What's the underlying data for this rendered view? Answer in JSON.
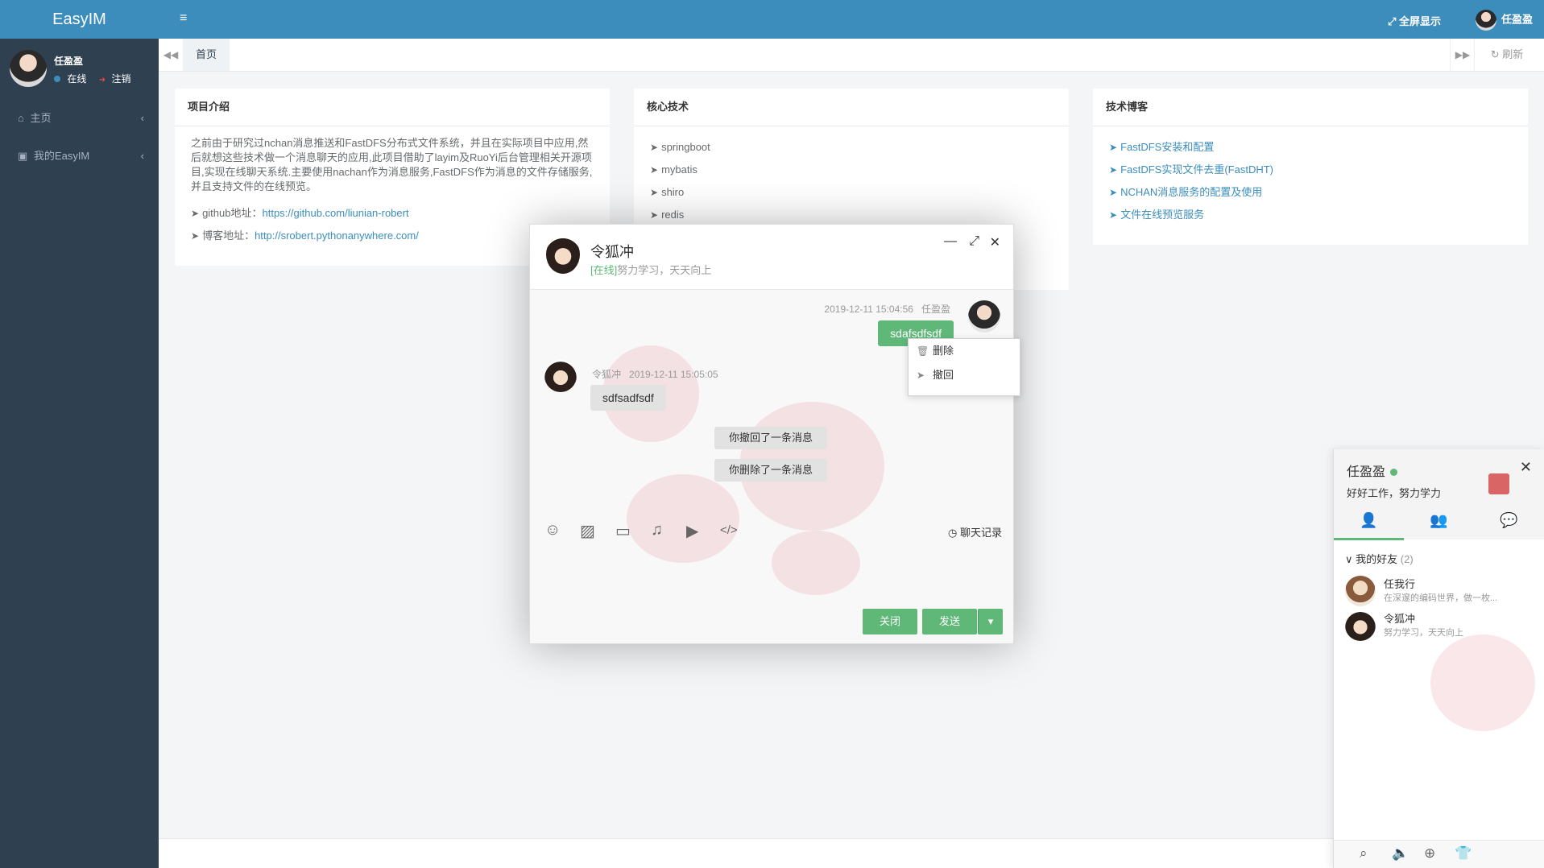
{
  "app": {
    "logo": "EasyIM"
  },
  "sidebar": {
    "user_name": "任盈盈",
    "status": "在线",
    "logout": "注销",
    "items": [
      {
        "icon": "home-icon",
        "glyph": "⌂",
        "label": "主页"
      },
      {
        "icon": "user-card-icon",
        "glyph": "▣",
        "label": "我的EasyIM"
      }
    ]
  },
  "topbar": {
    "menu_glyph": "≡",
    "fullscreen": "全屏显示",
    "user_name": "任盈盈"
  },
  "tabs": {
    "home": "首页",
    "refresh": "刷新"
  },
  "panels": {
    "intro": {
      "title": "项目介绍",
      "text": "之前由于研究过nchan消息推送和FastDFS分布式文件系统，并且在实际项目中应用,然后就想这些技术做一个消息聊天的应用,此项目借助了layim及RuoYi后台管理相关开源项目,实现在线聊天系统.主要使用nachan作为消息服务,FastDFS作为消息的文件存储服务,并且支持文件的在线预览。",
      "github_label": "github地址：",
      "github_url": "https://github.com/liunian-robert",
      "blog_label": "博客地址：",
      "blog_url": "http://srobert.pythonanywhere.com/"
    },
    "tech": {
      "title": "核心技术",
      "items": [
        "springboot",
        "mybatis",
        "shiro",
        "redis"
      ]
    },
    "blog": {
      "title": "技术博客",
      "items": [
        "FastDFS安装和配置",
        "FastDFS实现文件去重(FastDHT)",
        "NCHAN消息服务的配置及使用",
        "文件在线预览服务"
      ]
    }
  },
  "chat": {
    "name": "令狐冲",
    "status": "[在线]",
    "signature": "努力学习，天天向上",
    "messages": {
      "me": {
        "time": "2019-12-11 15:04:56",
        "name": "任盈盈",
        "text": "sdafsdfsdf"
      },
      "other": {
        "name": "令狐冲",
        "time": "2019-12-11 15:05:05",
        "text": "sdfsadfsdf"
      },
      "system": [
        "你撤回了一条消息",
        "你删除了一条消息"
      ]
    },
    "context_menu": [
      {
        "icon": "trash-icon",
        "glyph": "🗑",
        "label": "删除"
      },
      {
        "icon": "send-icon",
        "glyph": "➤",
        "label": "撤回"
      }
    ],
    "tools": [
      "smile-icon",
      "image-icon",
      "folder-icon",
      "headphones-icon",
      "video-icon",
      "code-icon"
    ],
    "tool_glyphs": [
      "☺",
      "▨",
      "▭",
      "♫",
      "▶",
      "</>"
    ],
    "history": "聊天记录",
    "buttons": {
      "close": "关闭",
      "send": "发送"
    }
  },
  "friends_panel": {
    "user_name": "任盈盈",
    "signature": "好好工作，努力学力",
    "group_name": "我的好友",
    "group_count": "(2)",
    "friends": [
      {
        "name": "任我行",
        "signature": "在深邃的编码世界，做一枚..."
      },
      {
        "name": "令狐冲",
        "signature": "努力学习，天天向上"
      }
    ]
  },
  "colors": {
    "sidebar": "#2f4050",
    "topbar": "#3c8dbc",
    "accent": "#5fb878",
    "link": "#3c8dbc"
  }
}
